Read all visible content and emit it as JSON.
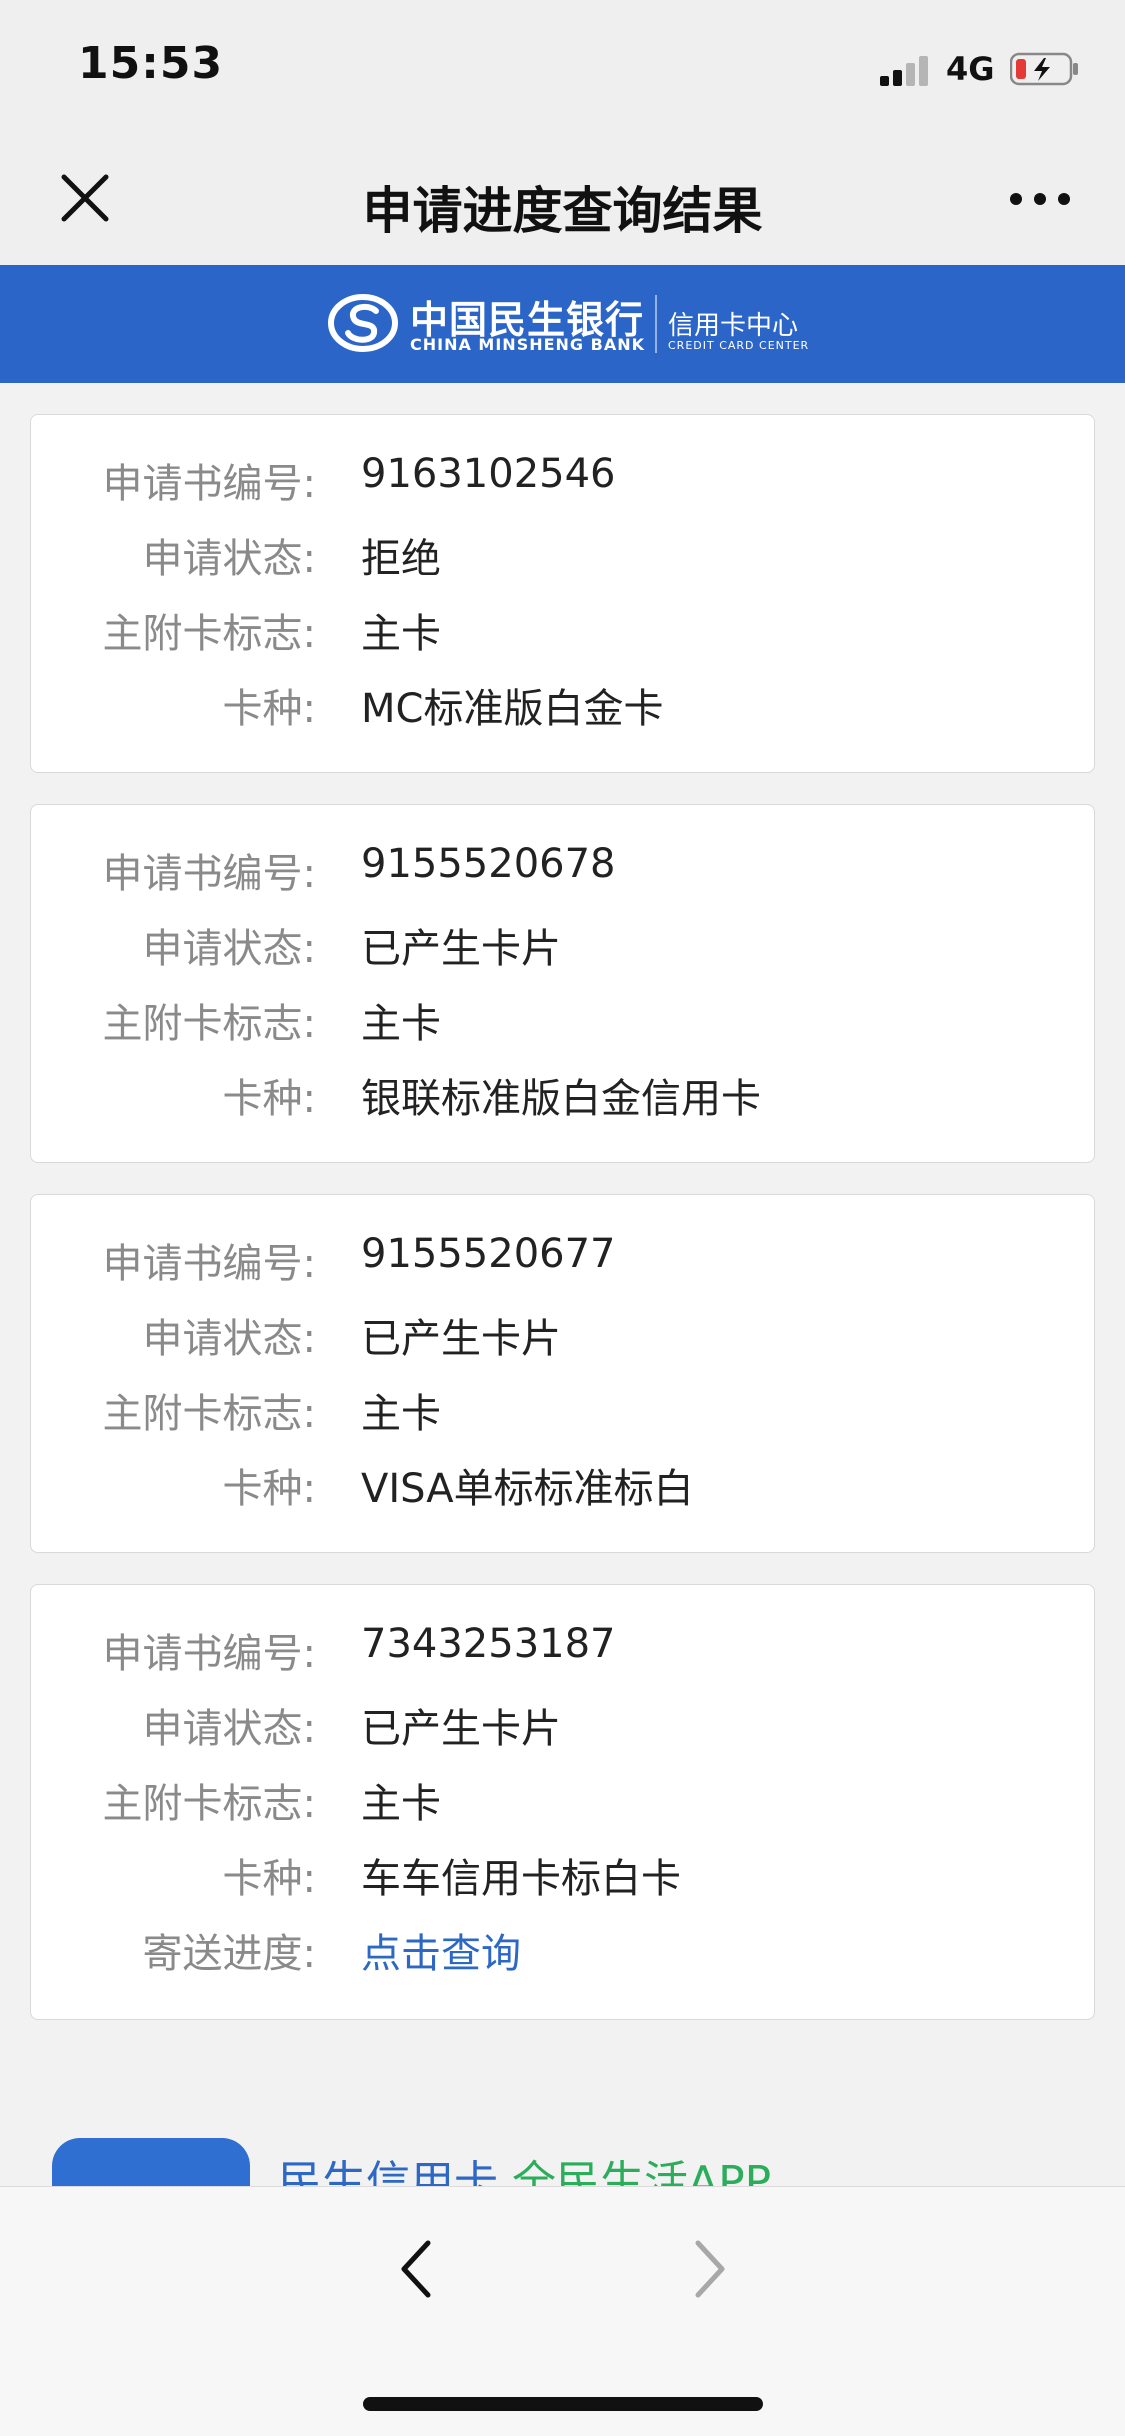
{
  "status_bar": {
    "time": "15:53",
    "network": "4G"
  },
  "nav": {
    "title": "申请进度查询结果"
  },
  "banner": {
    "bank_name_cn": "中国民生银行",
    "bank_name_en": "CHINA MINSHENG BANK",
    "center_cn": "信用卡中心",
    "center_en": "CREDIT CARD CENTER"
  },
  "labels": {
    "app_no": "申请书编号:",
    "status": "申请状态:",
    "card_flag": "主附卡标志:",
    "card_type": "卡种:",
    "delivery": "寄送进度:"
  },
  "applications": [
    {
      "app_no": "9163102546",
      "status": "拒绝",
      "card_flag": "主卡",
      "card_type": "MC标准版白金卡"
    },
    {
      "app_no": "9155520678",
      "status": "已产生卡片",
      "card_flag": "主卡",
      "card_type": "银联标准版白金信用卡"
    },
    {
      "app_no": "9155520677",
      "status": "已产生卡片",
      "card_flag": "主卡",
      "card_type": "VISA单标标准标白"
    },
    {
      "app_no": "7343253187",
      "status": "已产生卡片",
      "card_flag": "主卡",
      "card_type": "车车信用卡标白卡",
      "delivery_link": "点击查询"
    }
  ],
  "promo": {
    "text_part1": "民生信用卡",
    "text_part2": "全民生活APP"
  },
  "colors": {
    "brand_blue": "#2c65c8",
    "link_blue": "#2d68c4",
    "promo_green": "#2bad5b"
  }
}
